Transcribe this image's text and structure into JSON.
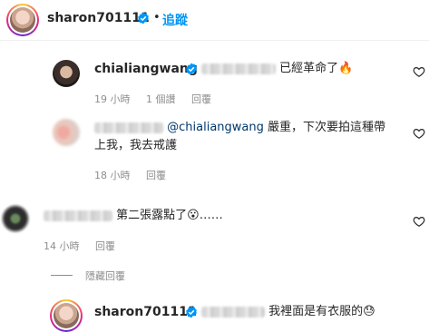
{
  "header": {
    "username": "sharon701111",
    "separator": "•",
    "follow_label": "追蹤"
  },
  "comments": [
    {
      "username": "chialiangwang",
      "text": "已經革命了",
      "emoji": "🔥",
      "time": "19 小時",
      "likes": "1 個讚",
      "reply": "回覆"
    },
    {
      "mention": "@chialiangwang",
      "text_line1": " 嚴重，下次要拍這種帶",
      "text_line2": "上我，我去戒護",
      "time": "18 小時",
      "reply": "回覆"
    },
    {
      "text": "第二張露點了",
      "emoji": "😮",
      "ellipsis": "……",
      "time": "14 小時",
      "reply": "回覆"
    }
  ],
  "hide_replies_label": "隱藏回覆",
  "reply_preview": {
    "username": "sharon701111",
    "text": "我裡面是有衣服的",
    "emoji": "😓"
  },
  "colors": {
    "follow": "#0095f6",
    "verified": "#0095f6",
    "meta": "#8e8e8e",
    "mention": "#00376b"
  }
}
